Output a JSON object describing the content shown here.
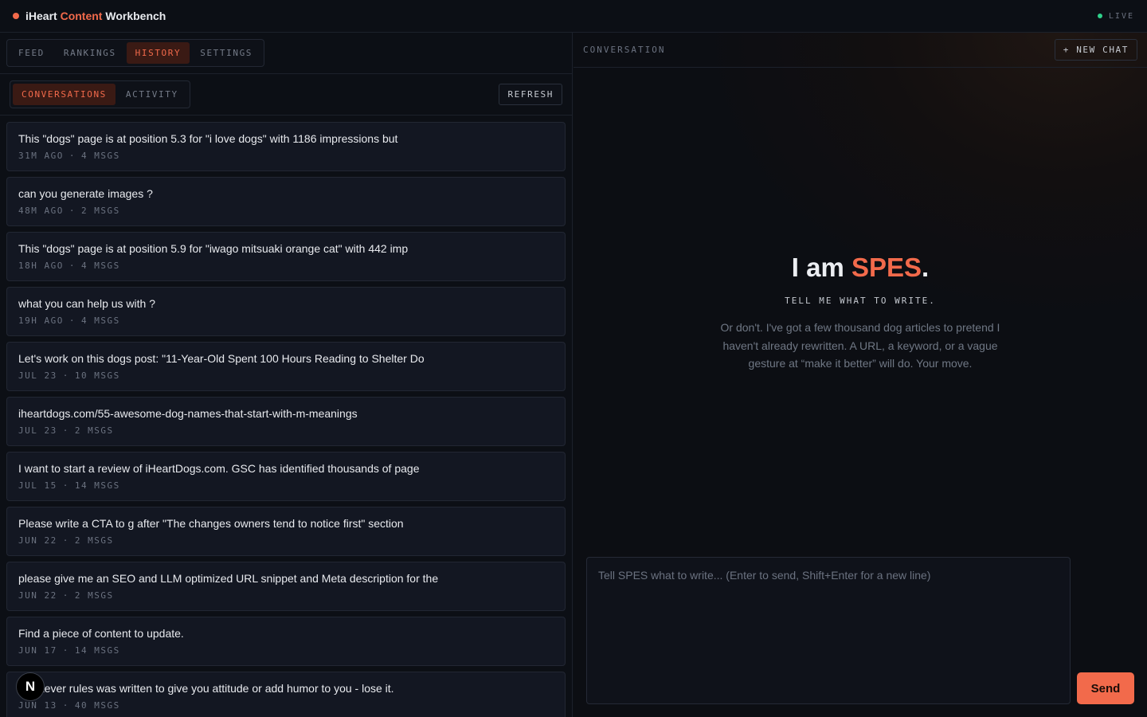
{
  "app": {
    "title_pre": "iHeart ",
    "title_accent": "Content",
    "title_post": " Workbench",
    "status": "LIVE"
  },
  "nav": {
    "tabs": [
      {
        "label": "FEED",
        "active": false
      },
      {
        "label": "RANKINGS",
        "active": false
      },
      {
        "label": "HISTORY",
        "active": true
      },
      {
        "label": "SETTINGS",
        "active": false
      }
    ]
  },
  "history": {
    "subtabs": [
      {
        "label": "CONVERSATIONS",
        "active": true
      },
      {
        "label": "ACTIVITY",
        "active": false
      }
    ],
    "refresh_label": "REFRESH",
    "meta_sep": "·",
    "conversations": [
      {
        "title": "This \"dogs\" page is at position 5.3 for \"i love dogs\" with 1186 impressions but",
        "time": "31M AGO",
        "msgs": "4 MSGS"
      },
      {
        "title": "can you generate images ?",
        "time": "48M AGO",
        "msgs": "2 MSGS"
      },
      {
        "title": "This \"dogs\" page is at position 5.9 for \"iwago mitsuaki orange cat\" with 442 imp",
        "time": "18H AGO",
        "msgs": "4 MSGS"
      },
      {
        "title": "what you can help us with ?",
        "time": "19H AGO",
        "msgs": "4 MSGS"
      },
      {
        "title": "Let's work on this dogs post: \"11-Year-Old Spent 100 Hours Reading to Shelter Do",
        "time": "JUL 23",
        "msgs": "10 MSGS"
      },
      {
        "title": "iheartdogs.com/55-awesome-dog-names-that-start-with-m-meanings",
        "time": "JUL 23",
        "msgs": "2 MSGS"
      },
      {
        "title": "I want to start a review of iHeartDogs.com. GSC has identified thousands of page",
        "time": "JUL 15",
        "msgs": "14 MSGS"
      },
      {
        "title": "Please write a CTA to g after \"The changes owners tend to notice first\" section",
        "time": "JUN 22",
        "msgs": "2 MSGS"
      },
      {
        "title": "please give me an SEO and LLM optimized URL snippet and Meta description for the",
        "time": "JUN 22",
        "msgs": "2 MSGS"
      },
      {
        "title": "Find a piece of content to update.",
        "time": "JUN 17",
        "msgs": "14 MSGS"
      },
      {
        "title": "Whatever rules was written to give you attitude or add humor to you - lose it.",
        "time": "JUN 13",
        "msgs": "40 MSGS"
      }
    ]
  },
  "conversation": {
    "header_label": "CONVERSATION",
    "new_chat_label": "+ NEW CHAT",
    "hero_pre": "I am ",
    "hero_accent": "SPES",
    "hero_post": ".",
    "hero_sub": "TELL ME WHAT TO WRITE.",
    "hero_desc": "Or don't. I've got a few thousand dog articles to pretend I haven't already rewritten. A URL, a keyword, or a vague gesture at “make it better” will do. Your move.",
    "input_placeholder": "Tell SPES what to write... (Enter to send, Shift+Enter for a new line)",
    "send_label": "Send"
  },
  "badge": {
    "letter": "N"
  },
  "colors": {
    "accent": "#f26a4b",
    "live": "#2fd08a",
    "background": "#0c0f15"
  }
}
